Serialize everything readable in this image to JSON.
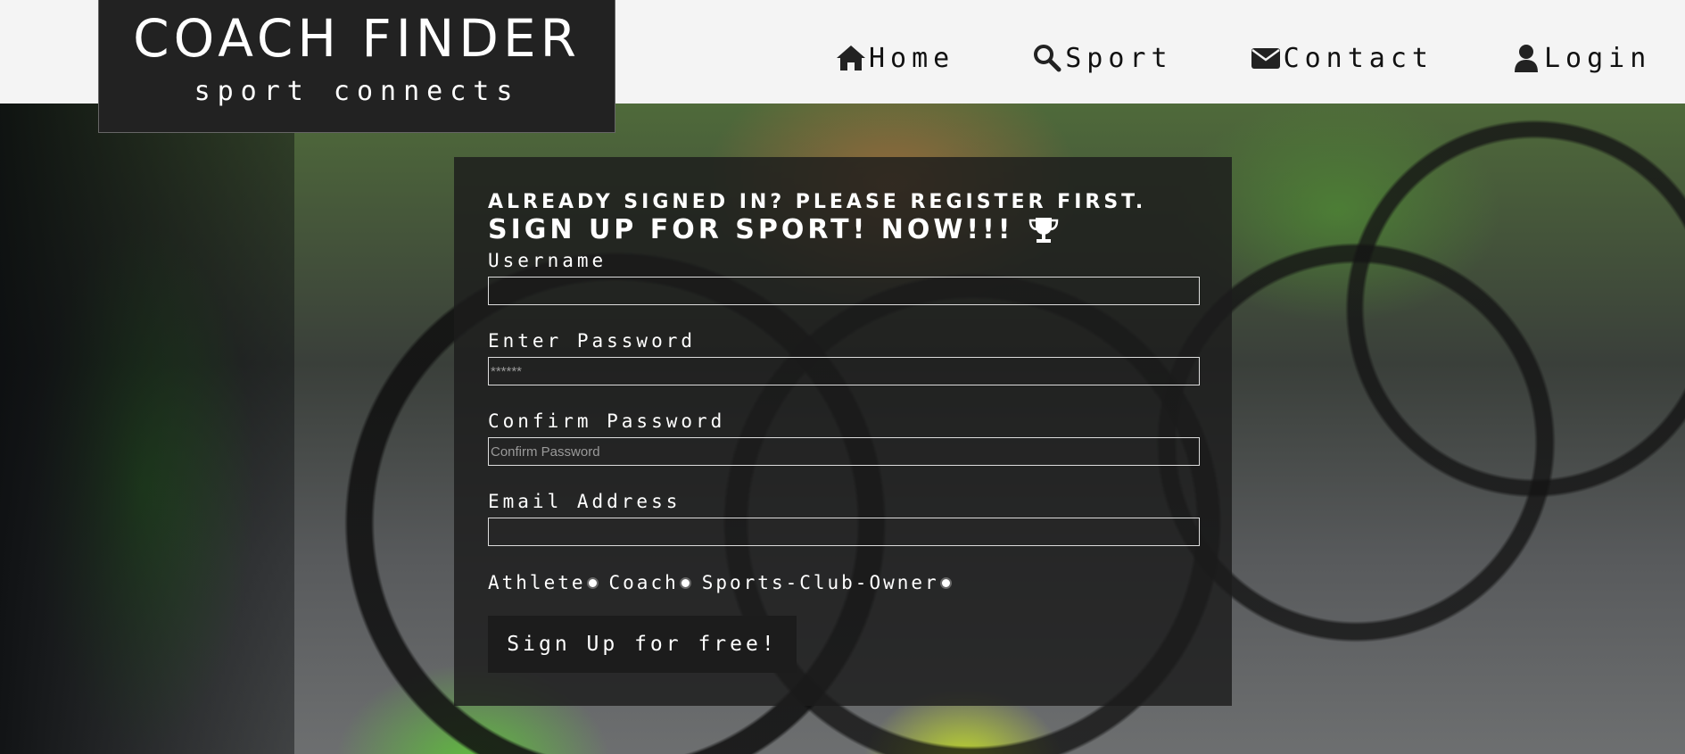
{
  "brand": {
    "title": "COACH FINDER",
    "subtitle": "sport connects"
  },
  "nav": {
    "home": {
      "label": "Home",
      "icon": "home-icon"
    },
    "sport": {
      "label": "Sport",
      "icon": "search-icon"
    },
    "contact": {
      "label": "Contact",
      "icon": "envelope-icon"
    },
    "login": {
      "label": "Login",
      "icon": "user-icon"
    }
  },
  "form": {
    "notice": "ALREADY SIGNED IN? PLEASE REGISTER FIRST.",
    "headline": "SIGN UP FOR SPORT! NOW!!!",
    "headline_icon": "trophy-icon",
    "username": {
      "label": "Username",
      "value": "",
      "placeholder": ""
    },
    "password": {
      "label": "Enter Password",
      "value": "",
      "placeholder": "******"
    },
    "confirm": {
      "label": "Confirm Password",
      "value": "",
      "placeholder": "Confirm Password"
    },
    "email": {
      "label": "Email Address",
      "value": "",
      "placeholder": ""
    },
    "roles": [
      "Athlete",
      "Coach",
      "Sports-Club-Owner"
    ],
    "submit_label": "Sign Up for free!"
  },
  "colors": {
    "topbar_bg": "#f4f4f4",
    "brand_bg": "#222222",
    "panel_bg": "rgba(28,28,28,0.82)",
    "text_light": "#ffffff",
    "nav_text": "#111111"
  }
}
